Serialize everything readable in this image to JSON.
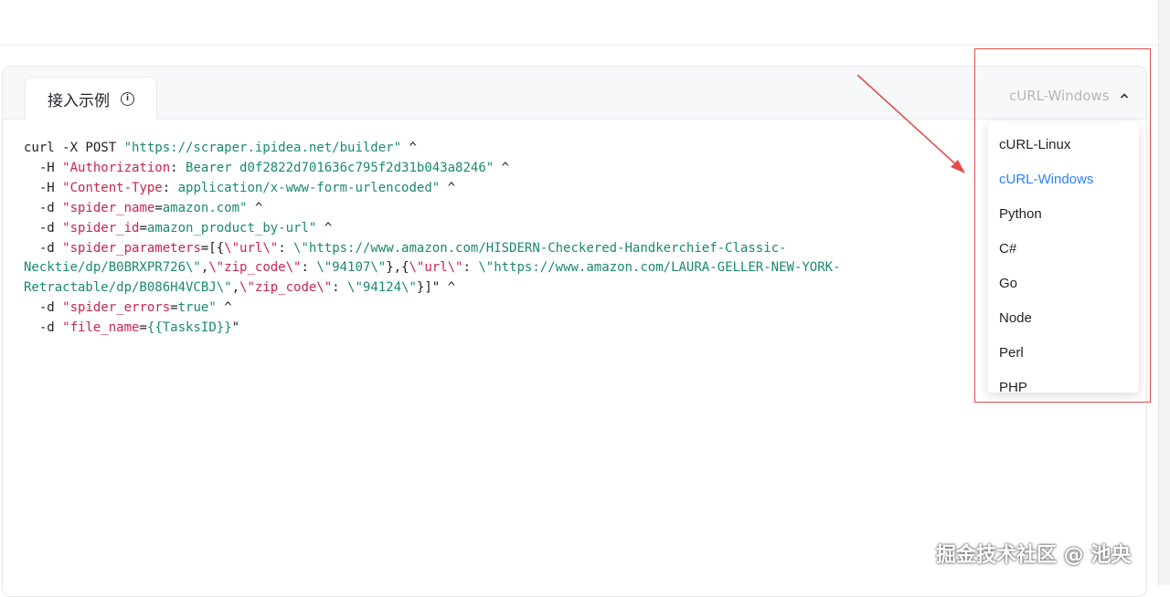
{
  "tab": {
    "label": "接入示例"
  },
  "selector": {
    "value": "cURL-Windows"
  },
  "code": {
    "lines": [
      [
        {
          "t": "curl -X POST "
        },
        {
          "c": "s",
          "t": "\"https://scraper.ipidea.net/builder\""
        },
        {
          "t": " ^"
        }
      ],
      [
        {
          "t": "  -H "
        },
        {
          "c": "k",
          "t": "\"Authorization"
        },
        {
          "t": ": "
        },
        {
          "c": "s",
          "t": "Bearer d0f2822d701636c795f2d31b043a8246\""
        },
        {
          "t": " ^"
        }
      ],
      [
        {
          "t": "  -H "
        },
        {
          "c": "k",
          "t": "\"Content-Type"
        },
        {
          "t": ": "
        },
        {
          "c": "s",
          "t": "application/x-www-form-urlencoded\""
        },
        {
          "t": " ^"
        }
      ],
      [
        {
          "t": "  -d "
        },
        {
          "c": "k",
          "t": "\"spider_name"
        },
        {
          "t": "="
        },
        {
          "c": "s",
          "t": "amazon.com\""
        },
        {
          "t": " ^"
        }
      ],
      [
        {
          "t": "  -d "
        },
        {
          "c": "k",
          "t": "\"spider_id"
        },
        {
          "t": "="
        },
        {
          "c": "s",
          "t": "amazon_product_by-url\""
        },
        {
          "t": " ^"
        }
      ],
      [
        {
          "t": "  -d "
        },
        {
          "c": "k",
          "t": "\"spider_parameters"
        },
        {
          "t": "=[{"
        },
        {
          "c": "k",
          "t": "\\\"url\\\""
        },
        {
          "t": ": "
        },
        {
          "c": "s",
          "t": "\\\"https://www.amazon.com/HISDERN-Checkered-Handkerchief-Classic-"
        }
      ],
      [
        {
          "c": "s",
          "t": "Necktie/dp/B0BRXPR726\\\""
        },
        {
          "t": ","
        },
        {
          "c": "k",
          "t": "\\\"zip_code\\\""
        },
        {
          "t": ": "
        },
        {
          "c": "s",
          "t": "\\\"94107\\\""
        },
        {
          "t": "},{"
        },
        {
          "c": "k",
          "t": "\\\"url\\\""
        },
        {
          "t": ": "
        },
        {
          "c": "s",
          "t": "\\\"https://www.amazon.com/LAURA-GELLER-NEW-YORK-"
        }
      ],
      [
        {
          "c": "s",
          "t": "Retractable/dp/B086H4VCBJ\\\""
        },
        {
          "t": ","
        },
        {
          "c": "k",
          "t": "\\\"zip_code\\\""
        },
        {
          "t": ": "
        },
        {
          "c": "s",
          "t": "\\\"94124\\\""
        },
        {
          "t": "}]\" ^"
        }
      ],
      [
        {
          "t": "  -d "
        },
        {
          "c": "k",
          "t": "\"spider_errors"
        },
        {
          "t": "="
        },
        {
          "c": "s",
          "t": "true\""
        },
        {
          "t": " ^"
        }
      ],
      [
        {
          "t": "  -d "
        },
        {
          "c": "k",
          "t": "\"file_name"
        },
        {
          "t": "="
        },
        {
          "c": "s",
          "t": "{{TasksID}}"
        },
        {
          "t": "\""
        }
      ]
    ]
  },
  "dropdown": {
    "items": [
      {
        "label": "cURL-Linux",
        "active": false
      },
      {
        "label": "cURL-Windows",
        "active": true
      },
      {
        "label": "Python",
        "active": false
      },
      {
        "label": "C#",
        "active": false
      },
      {
        "label": "Go",
        "active": false
      },
      {
        "label": "Node",
        "active": false
      },
      {
        "label": "Perl",
        "active": false
      },
      {
        "label": "PHP",
        "active": false
      }
    ]
  },
  "watermark": "掘金技术社区 @ 池央",
  "colors": {
    "accent": "#2f7ff5",
    "annotation": "#e24d4d",
    "code_key": "#c7254e",
    "code_string": "#1a8a6f"
  }
}
